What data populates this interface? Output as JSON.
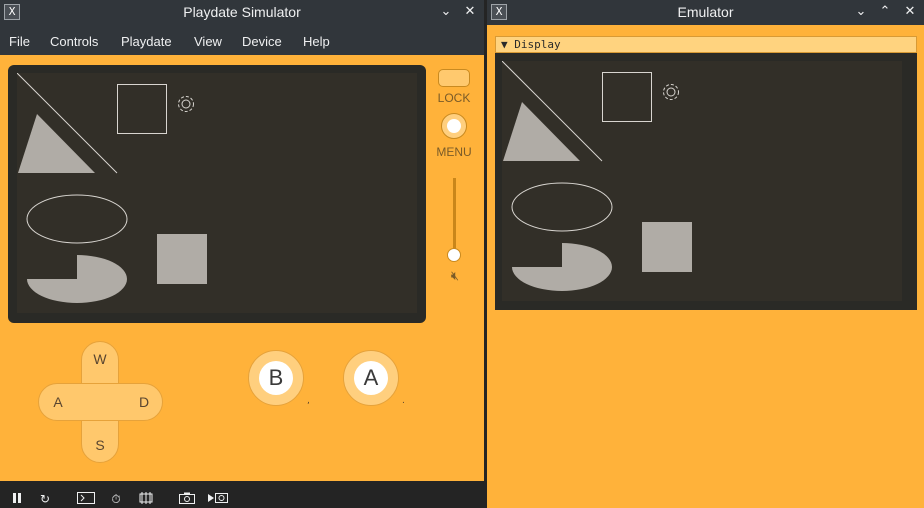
{
  "simulator": {
    "title": "Playdate Simulator",
    "app_icon": "X",
    "menu": [
      "File",
      "Controls",
      "Playdate",
      "View",
      "Device",
      "Help"
    ],
    "lock_label": "LOCK",
    "menu_label": "MENU",
    "dpad": {
      "up": "W",
      "left": "A",
      "right": "D",
      "down": "S"
    },
    "buttons": {
      "b": "B",
      "a": "A"
    },
    "crank_level": 1.0,
    "icons": [
      "chevron-down-icon",
      "close-icon",
      "pause-icon",
      "restart-icon",
      "console-icon",
      "timer-icon",
      "memory-icon",
      "camera-icon",
      "video-camera-icon",
      "mute-icon",
      "gear-icon"
    ]
  },
  "emulator": {
    "title": "Emulator",
    "app_icon": "X",
    "panel_header": "▼ Display",
    "icons": [
      "chevron-down-icon",
      "chevron-up-icon",
      "close-icon"
    ]
  },
  "colors": {
    "body": "#ffb23a",
    "screen": "#322f28",
    "shape": "#b0aca6",
    "titlebar": "#31363b"
  }
}
